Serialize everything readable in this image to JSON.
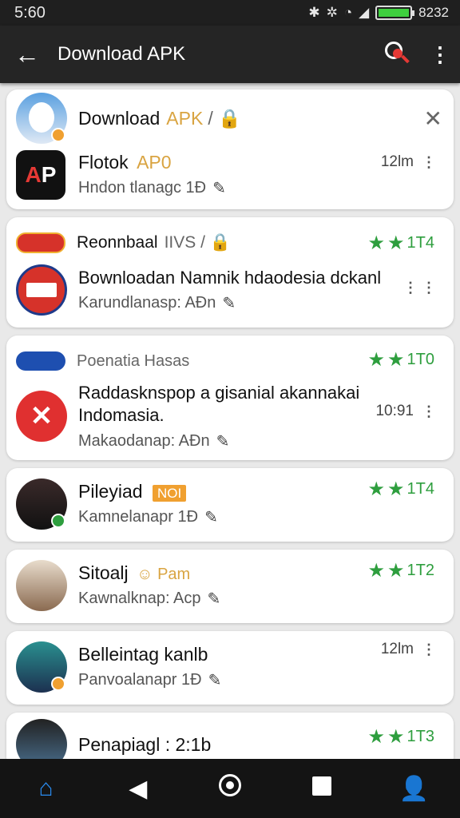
{
  "status_bar": {
    "time": "5:60",
    "right_text": "8232",
    "icons": [
      "bluetooth-icon",
      "signal-icon",
      "wifi-icon",
      "cell-icon",
      "battery-icon"
    ]
  },
  "app_bar": {
    "title": "Download APK",
    "back_icon": "arrow-left-icon",
    "search_icon": "search-icon",
    "more_icon": "more-vert-icon"
  },
  "colors": {
    "accent_green": "#2e9e3e",
    "accent_orange": "#d9a441",
    "nav_home_blue": "#2a8cf0",
    "red": "#e53935"
  },
  "cards": [
    {
      "header_title": "Download",
      "header_accent": "APK",
      "header_suffix": "/ 🔒",
      "item_title": "Flotok",
      "item_title_accent": "AP0",
      "item_subtitle": "Hndon tlanagc 1Đ",
      "time": "12lm"
    },
    {
      "header_title": "Reonnbaal",
      "header_suffix": "IIVS / 🔒",
      "rating": "1T4",
      "item_title": "Bownloadan Namnik hdaodesia dckanl",
      "item_subtitle": "Karundlanasp: AĐn"
    },
    {
      "header_title": "Poenatia Hasas",
      "rating": "1T0",
      "item_title": "Raddasknspop a gisanial akannakai Indomasia.",
      "item_subtitle": "Makaodanap: AĐn",
      "time": "10:91"
    },
    {
      "title": "Pileyiad",
      "badge": "NOI",
      "subtitle": "Kamnelanapr 1Đ",
      "rating": "1T4"
    },
    {
      "title": "Sitoalj",
      "accent": "☺ Pam",
      "subtitle": "Kawnalknap: Acp",
      "rating": "1T2"
    },
    {
      "title": "Belleintag kanlb",
      "subtitle": "Panvoalanapr 1Đ",
      "time": "12lm"
    },
    {
      "title": "Penapiagl : 2:1b",
      "rating": "1T3"
    }
  ],
  "nav_bar": {
    "items": [
      "home-icon",
      "back-icon",
      "home-circle-icon",
      "recents-icon",
      "profile-icon"
    ]
  }
}
